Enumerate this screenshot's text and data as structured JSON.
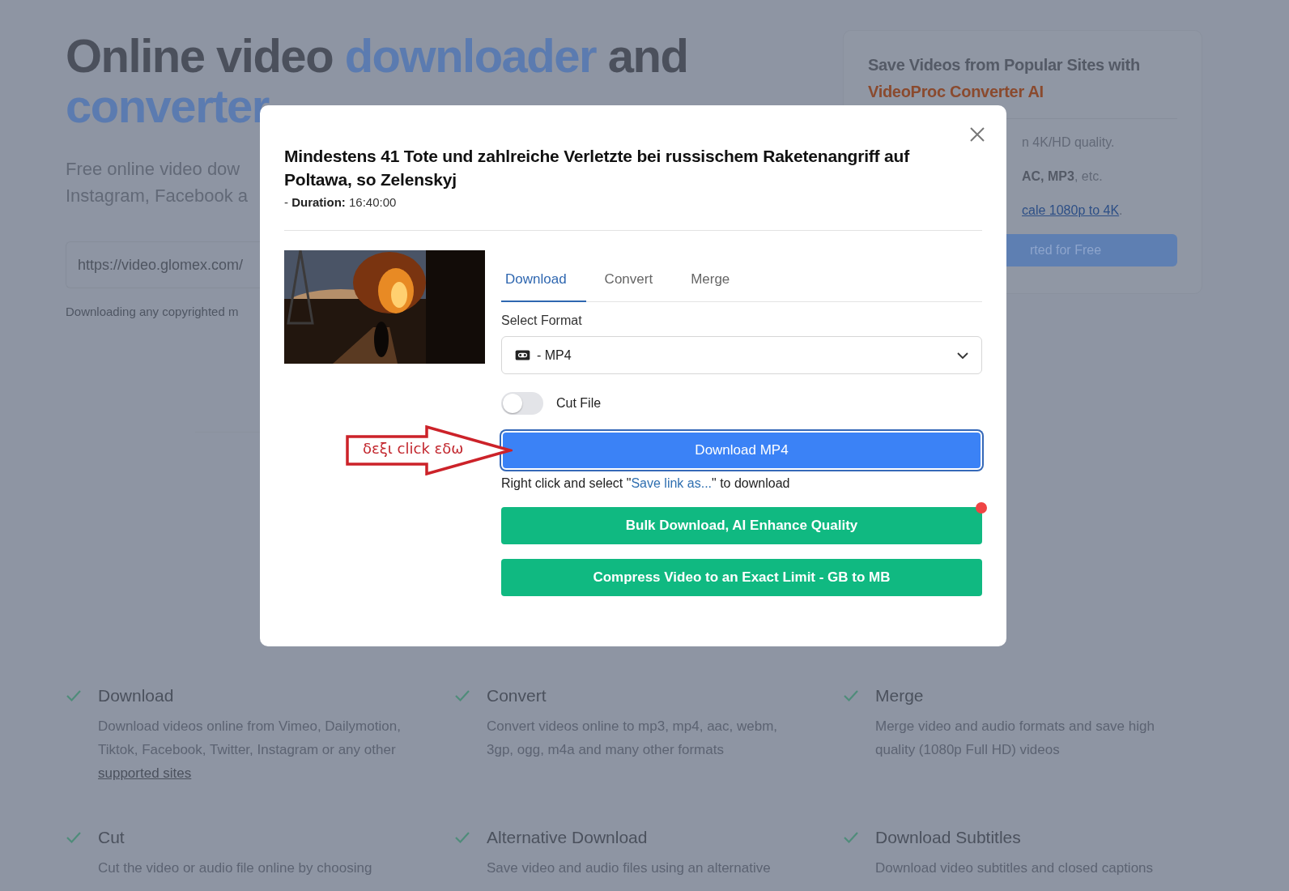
{
  "hero": {
    "title_parts": [
      {
        "text": "Online video ",
        "kind": "plain"
      },
      {
        "text": "downloader",
        "kind": "accent"
      },
      {
        "text": " and ",
        "kind": "plain"
      },
      {
        "text": "converter",
        "kind": "accent"
      }
    ],
    "subtitle_lines": [
      "Free online video dow",
      "Instagram, Facebook a"
    ],
    "url_field": {
      "value": "https://video.glomex.com/"
    },
    "notice": "Downloading any copyrighted m"
  },
  "promo": {
    "title": "Save Videos from Popular Sites with",
    "brand": "VideoProc Converter AI",
    "lines": [
      {
        "kind": "text",
        "text": "n 4K/HD quality."
      },
      {
        "kind": "text",
        "text": "**AC, MP3**, etc."
      },
      {
        "kind": "link",
        "text": "cale 1080p to 4K",
        "suffix": "."
      }
    ],
    "button": "rted for Free"
  },
  "features": [
    {
      "title": "Download",
      "description": "Download videos online from Vimeo, Dailymotion, Tiktok, Facebook, Twitter, Instagram or any other",
      "link": "supported sites"
    },
    {
      "title": "Convert",
      "description": "Convert videos online to mp3, mp4, aac, webm, 3gp, ogg, m4a and many other formats"
    },
    {
      "title": "Merge",
      "description": "Merge video and audio formats and save high quality (1080p Full HD) videos"
    },
    {
      "title": "Cut",
      "description": "Cut the video or audio file online by choosing"
    },
    {
      "title": "Alternative Download",
      "description": "Save video and audio files using an alternative"
    },
    {
      "title": "Download Subtitles",
      "description": "Download video subtitles and closed captions"
    }
  ],
  "modal": {
    "title": "Mindestens 41 Tote und zahlreiche Verletzte bei russischem Raketenangriff auf Poltawa, so Zelenskyj",
    "meta": "- **Duration:** 16:40:00",
    "tabs": [
      {
        "label": "Download",
        "selected": true
      },
      {
        "label": "Convert",
        "selected": false
      },
      {
        "label": "Merge",
        "selected": false
      }
    ],
    "format_label": "Select Format",
    "format": "- MP4",
    "cut_file": {
      "label": "Cut File",
      "on": false
    },
    "download_button": "Download MP4",
    "hint": {
      "before": "Right click and select \"",
      "link": "Save link as...",
      "after": "\" to download"
    },
    "actions": [
      {
        "label": "Bulk Download, AI Enhance Quality",
        "badge": true
      },
      {
        "label": "Compress Video to an Exact Limit - GB to MB",
        "badge": false
      }
    ]
  },
  "annotation": {
    "text": "δεξι click εδω"
  }
}
